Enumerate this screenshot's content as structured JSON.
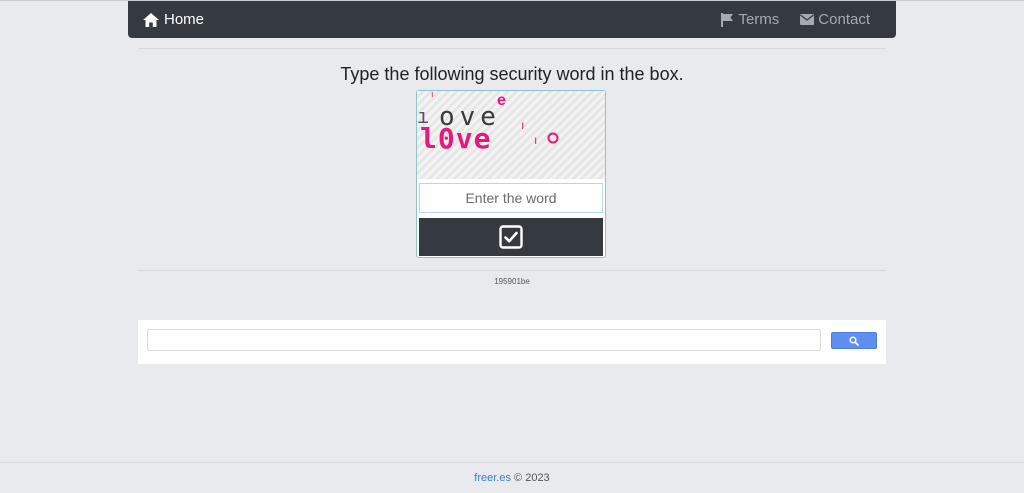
{
  "nav": {
    "home_label": "Home",
    "terms_label": "Terms",
    "contact_label": "Contact",
    "home_icon": "home-icon",
    "terms_icon": "flag-icon",
    "contact_icon": "envelope-icon"
  },
  "captcha": {
    "instruction": "Type the following security word in the box.",
    "input_placeholder": "Enter the word",
    "input_value": "",
    "submit_icon": "check-square-icon",
    "code": "195901be"
  },
  "search": {
    "value": "",
    "button_icon": "search-icon"
  },
  "footer": {
    "site": "freer.es",
    "copyright": "© 2023"
  },
  "colors": {
    "navbar": "#343a40",
    "background": "#e9eaed",
    "search_button": "#5e8ff0",
    "captcha_pink": "#e6197a"
  }
}
